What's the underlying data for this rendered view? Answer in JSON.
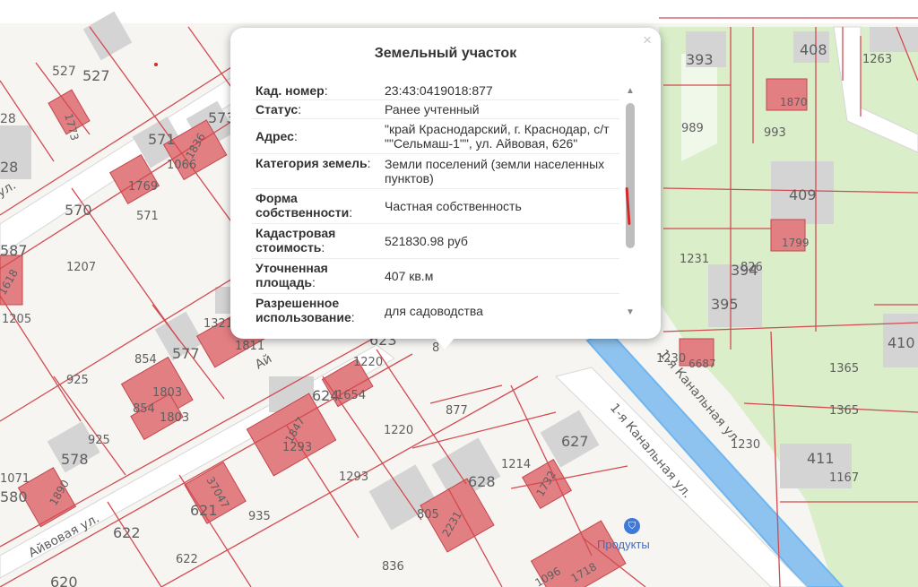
{
  "popup": {
    "title": "Земельный участок",
    "close_symbol": "×",
    "rows": [
      {
        "label": "Кад. номер",
        "value": "23:43:0419018:877"
      },
      {
        "label": "Статус",
        "value": "Ранее учтенный"
      },
      {
        "label": "Адрес",
        "value": "\"край Краснодарский, г. Краснодар, с/т \"\"Сельмаш-1\"\", ул. Айвовая, 626\""
      },
      {
        "label": "Категория земель",
        "value": "Земли поселений (земли населенных пунктов)"
      },
      {
        "label": "Форма собственности",
        "value": "Частная собственность"
      },
      {
        "label": "Кадастровая стоимость",
        "value": "521830.98 руб"
      },
      {
        "label": "Уточненная площадь",
        "value": "407 кв.м"
      },
      {
        "label": "Разрешенное использование",
        "value": "для садоводства"
      }
    ],
    "scroll_up_symbol": "▲",
    "scroll_down_symbol": "▼"
  },
  "map": {
    "street_labels": [
      "Айвовая ул.",
      "Ай",
      "1-я Канальная ул.",
      "1-я Канальная ул."
    ],
    "poi": {
      "label": "Продукты",
      "icon": "shopping-basket-icon"
    },
    "parcel_numbers": [
      "527",
      "527",
      "1773",
      "571",
      "573",
      "28",
      "1066",
      "1836",
      "1769",
      "571",
      "570",
      "587",
      "1207",
      "1618",
      "1205",
      "1321",
      "1811",
      "854",
      "577",
      "925",
      "1803",
      "854",
      "1803",
      "925",
      "1071",
      "580",
      "1890",
      "578",
      "1220",
      "1654",
      "624",
      "623",
      "877",
      "1220",
      "1847",
      "1293",
      "1293",
      "1214",
      "627",
      "628",
      "1732",
      "37047",
      "621",
      "935",
      "805",
      "2231",
      "622",
      "836",
      "622",
      "1718",
      "1096",
      "620",
      "393",
      "408",
      "1263",
      "1870",
      "989",
      "993",
      "409",
      "1799",
      "1231",
      "826",
      "394",
      "395",
      "1230",
      "6687",
      "1365",
      "1365",
      "410",
      "1230",
      "411",
      "1167"
    ],
    "colors": {
      "parcel_line": "#d24b50",
      "building": "#e07b7f",
      "water": "#6fb6f0",
      "green": "#d9eec9",
      "road": "#ffffff"
    }
  }
}
